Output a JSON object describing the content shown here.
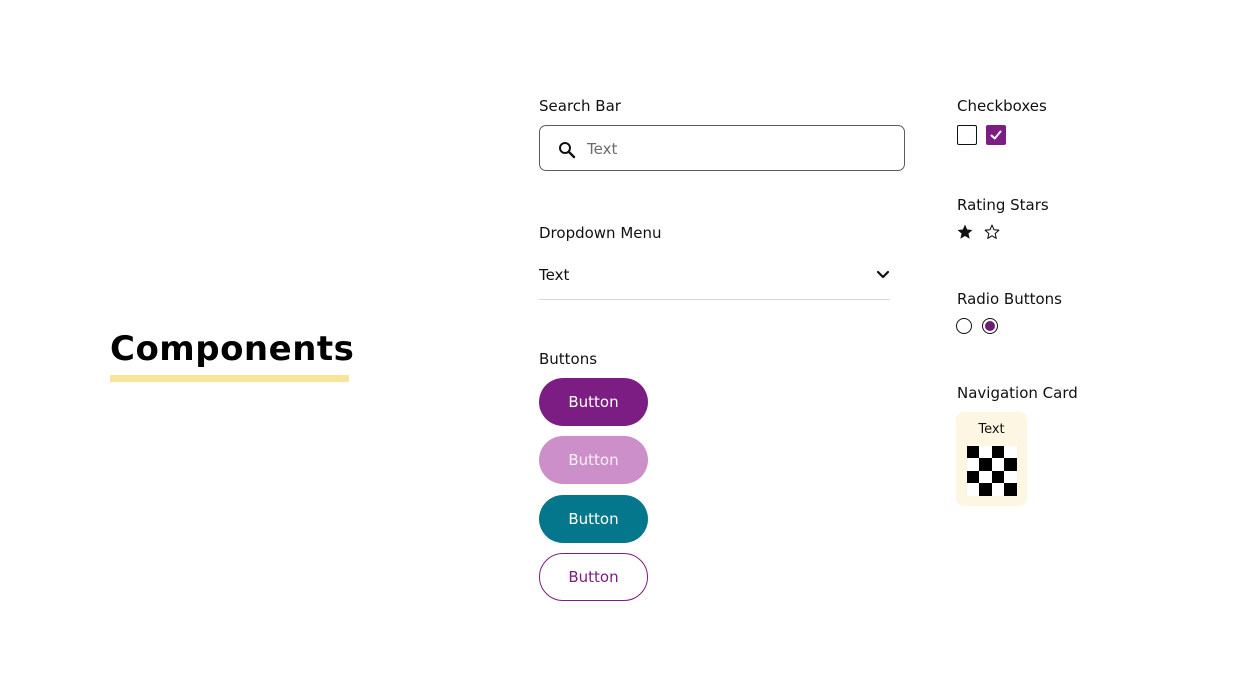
{
  "page": {
    "title": "Components",
    "accent_underline_color": "#f9e59a"
  },
  "search_bar": {
    "label": "Search Bar",
    "placeholder": "Text",
    "icon": "search-icon"
  },
  "dropdown": {
    "label": "Dropdown Menu",
    "selected_value": "Text",
    "icon": "chevron-down-icon"
  },
  "buttons": {
    "label": "Buttons",
    "items": [
      {
        "label": "Button",
        "variant": "primary",
        "color": "#7b1d82"
      },
      {
        "label": "Button",
        "variant": "disabled",
        "color": "#cc8fc9"
      },
      {
        "label": "Button",
        "variant": "secondary",
        "color": "#05778c"
      },
      {
        "label": "Button",
        "variant": "outline",
        "color": "#7b1d82"
      }
    ]
  },
  "checkboxes": {
    "label": "Checkboxes",
    "items": [
      {
        "checked": false
      },
      {
        "checked": true,
        "color": "#7b1d82"
      }
    ]
  },
  "rating_stars": {
    "label": "Rating Stars",
    "items": [
      {
        "filled": true,
        "icon": "star-filled-icon"
      },
      {
        "filled": false,
        "icon": "star-outline-icon"
      }
    ]
  },
  "radio_buttons": {
    "label": "Radio Buttons",
    "items": [
      {
        "selected": false
      },
      {
        "selected": true,
        "color": "#6a1f73"
      }
    ]
  },
  "navigation_card": {
    "label": "Navigation Card",
    "card_text": "Text",
    "card_background": "#fdf6e3",
    "icon": "checker-pattern-icon"
  }
}
